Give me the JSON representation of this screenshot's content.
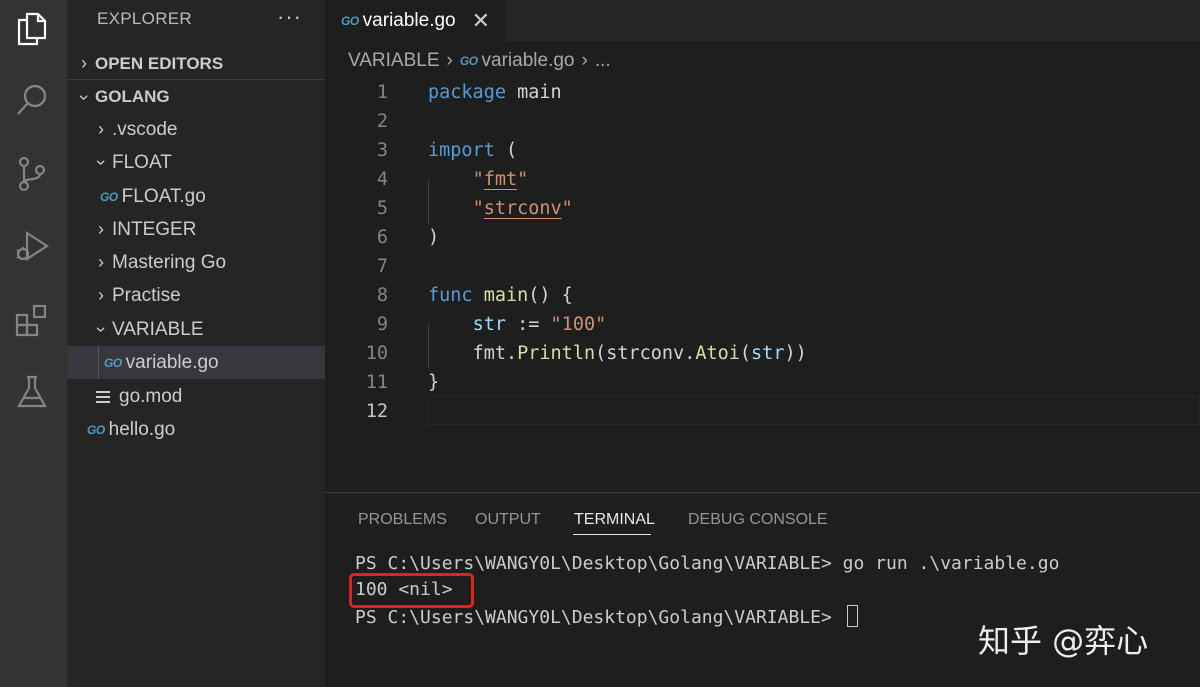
{
  "activity_bar": {
    "icons": [
      "explorer-icon",
      "search-icon",
      "source-control-icon",
      "run-debug-icon",
      "extensions-icon",
      "testing-icon"
    ]
  },
  "sidebar": {
    "title": "EXPLORER",
    "more": "···",
    "open_editors": "OPEN EDITORS",
    "root": "GOLANG",
    "items": [
      {
        "label": ".vscode",
        "type": "folder",
        "expanded": false
      },
      {
        "label": "FLOAT",
        "type": "folder",
        "expanded": true
      },
      {
        "label": "FLOAT.go",
        "type": "go-file"
      },
      {
        "label": "INTEGER",
        "type": "folder",
        "expanded": false
      },
      {
        "label": "Mastering Go",
        "type": "folder",
        "expanded": false
      },
      {
        "label": "Practise",
        "type": "folder",
        "expanded": false
      },
      {
        "label": "VARIABLE",
        "type": "folder",
        "expanded": true
      },
      {
        "label": "variable.go",
        "type": "go-file",
        "selected": true
      },
      {
        "label": "go.mod",
        "type": "mod-file"
      },
      {
        "label": "hello.go",
        "type": "go-file"
      }
    ]
  },
  "editor": {
    "tab_label": "variable.go",
    "tab_close": "✕",
    "go_badge": "GO",
    "breadcrumb": {
      "folder": "VARIABLE",
      "file": "variable.go",
      "ellipsis": "..."
    },
    "line_numbers": [
      "1",
      "2",
      "3",
      "4",
      "5",
      "6",
      "7",
      "8",
      "9",
      "10",
      "11",
      "12"
    ],
    "code_lines": [
      "package main",
      "",
      "import (",
      "\"fmt\"",
      "\"strconv\"",
      ")",
      "",
      "func main() {",
      "str := \"100\"",
      "fmt.Println(strconv.Atoi(str))",
      "}",
      ""
    ]
  },
  "panel": {
    "tabs": [
      "PROBLEMS",
      "OUTPUT",
      "TERMINAL",
      "DEBUG CONSOLE"
    ],
    "active_tab": "TERMINAL",
    "terminal_lines": [
      "PS C:\\Users\\WANGY0L\\Desktop\\Golang\\VARIABLE> go run .\\variable.go",
      "100 <nil>",
      "PS C:\\Users\\WANGY0L\\Desktop\\Golang\\VARIABLE> "
    ]
  },
  "watermark": "知乎 @弈心",
  "colors": {
    "activity_bar": "#333333",
    "sidebar": "#252526",
    "editor": "#1e1e1e",
    "keyword": "#569cd6",
    "function": "#dcdcaa",
    "string": "#ce9178",
    "highlight_box": "#e0241b"
  }
}
